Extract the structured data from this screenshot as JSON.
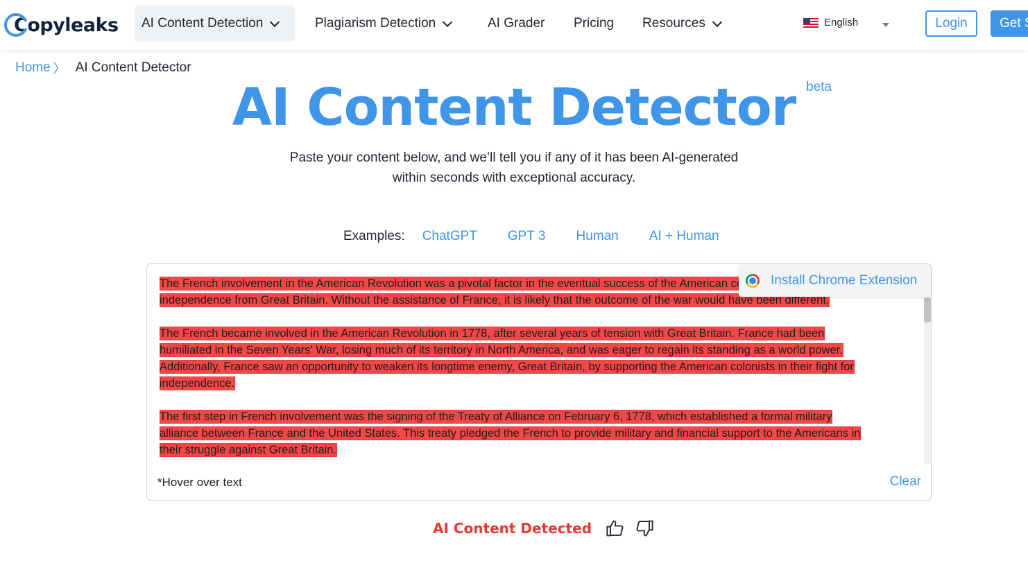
{
  "nav": {
    "logo": "Copyleaks",
    "items": [
      {
        "label": "AI Content Detection"
      },
      {
        "label": "Plagiarism Detection"
      },
      {
        "label": "AI Grader"
      },
      {
        "label": "Pricing"
      },
      {
        "label": "Resources"
      }
    ],
    "language": "English",
    "login": "Login",
    "get_started": "Get S"
  },
  "breadcrumb": {
    "home": "Home",
    "separator": "〉",
    "current": "AI Content Detector"
  },
  "hero": {
    "title": "AI Content Detector",
    "badge": "beta",
    "subtitle_line1": "Paste your content below, and we’ll tell you if any of it has been AI-generated",
    "subtitle_line2": "within seconds with exceptional accuracy."
  },
  "examples": {
    "label": "Examples:",
    "items": [
      "ChatGPT",
      "GPT 3",
      "Human",
      "AI + Human"
    ]
  },
  "editor": {
    "paragraphs": [
      {
        "lines": [
          "The French involvement in the American Revolution was a pivotal factor in the eventual success of the American colonies in achieving",
          "independence from Great Britain. Without the assistance of France, it is likely that the outcome of the war would have been different."
        ]
      },
      {
        "lines": [
          "The French became involved in the American Revolution in 1778, after several years of tension with Great Britain. France had been",
          "humiliated in the Seven Years' War, losing much of its territory in North America, and was eager to regain its standing as a world power.",
          "Additionally, France saw an opportunity to weaken its longtime enemy, Great Britain, by supporting the American colonists in their fight for",
          "independence."
        ]
      },
      {
        "lines": [
          "The first step in French involvement was the signing of the Treaty of Alliance on February 6, 1778, which established a formal military",
          "alliance between France and the United States. This treaty pledged the French to provide military and financial support to the Americans in",
          "their struggle against Great Britain."
        ]
      }
    ],
    "chrome_extension": "Install Chrome Extension",
    "hover_note": "*Hover over text",
    "clear": "Clear",
    "highlight_color": "#f24747"
  },
  "result": {
    "label": "AI Content Detected",
    "color": "#e53935",
    "thumbs_up_icon": "thumbs-up-icon",
    "thumbs_down_icon": "thumbs-down-icon"
  },
  "colors": {
    "accent": "#3f95e8"
  }
}
